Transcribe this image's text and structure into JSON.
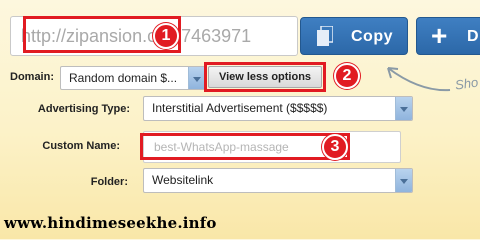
{
  "url_field": {
    "value": "http://zipansion.co/17463971"
  },
  "copy_button": {
    "label": "Copy"
  },
  "add_button": {
    "label": "D"
  },
  "domain": {
    "label": "Domain:",
    "selected": "Random domain $..."
  },
  "view_less_button": {
    "label": "View less options"
  },
  "hint_text": "Sho",
  "advertising_type": {
    "label": "Advertising Type:",
    "selected": "Interstitial Advertisement ($$$$$)"
  },
  "custom_name": {
    "label": "Custom Name:",
    "value": "best-WhatsApp-massage"
  },
  "folder": {
    "label": "Folder:",
    "selected": "Websitelink"
  },
  "badges": {
    "one": "1",
    "two": "2",
    "three": "3"
  },
  "watermark": "www.hindimeseekhe.info",
  "colors": {
    "accent_blue": "#2c68a8",
    "annotation_red": "#e11b22"
  },
  "icons": {
    "copy": "copy-icon",
    "add": "plus-icon",
    "dropdown": "chevron-down-icon",
    "arrow": "curved-arrow-icon"
  }
}
